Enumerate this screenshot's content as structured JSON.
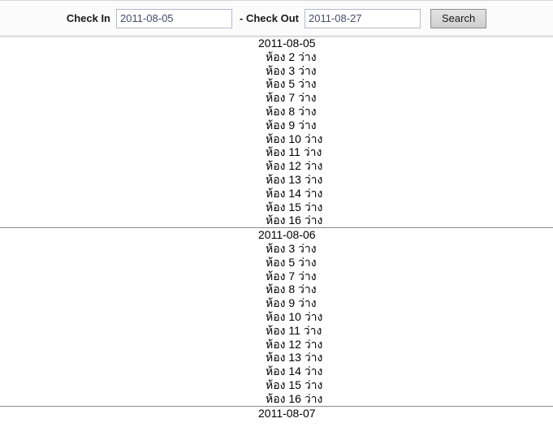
{
  "search_bar": {
    "checkin_label": "Check In",
    "checkin_value": "2011-08-05",
    "separator": "-",
    "checkout_label": "Check Out",
    "checkout_value": "2011-08-27",
    "search_label": "Search"
  },
  "availability": {
    "room_word": "ห้อง",
    "status_word": "ว่าง",
    "days": [
      {
        "date": "2011-08-05",
        "rooms": [
          "ห้อง 2 ว่าง",
          "ห้อง 3 ว่าง",
          "ห้อง 5 ว่าง",
          "ห้อง 7 ว่าง",
          "ห้อง 8 ว่าง",
          "ห้อง 9 ว่าง",
          "ห้อง 10 ว่าง",
          "ห้อง 11 ว่าง",
          "ห้อง 12 ว่าง",
          "ห้อง 13 ว่าง",
          "ห้อง 14 ว่าง",
          "ห้อง 15 ว่าง",
          "ห้อง 16 ว่าง"
        ]
      },
      {
        "date": "2011-08-06",
        "rooms": [
          "ห้อง 3 ว่าง",
          "ห้อง 5 ว่าง",
          "ห้อง 7 ว่าง",
          "ห้อง 8 ว่าง",
          "ห้อง 9 ว่าง",
          "ห้อง 10 ว่าง",
          "ห้อง 11 ว่าง",
          "ห้อง 12 ว่าง",
          "ห้อง 13 ว่าง",
          "ห้อง 14 ว่าง",
          "ห้อง 15 ว่าง",
          "ห้อง 16 ว่าง"
        ]
      },
      {
        "date": "2011-08-07",
        "rooms": []
      }
    ]
  }
}
